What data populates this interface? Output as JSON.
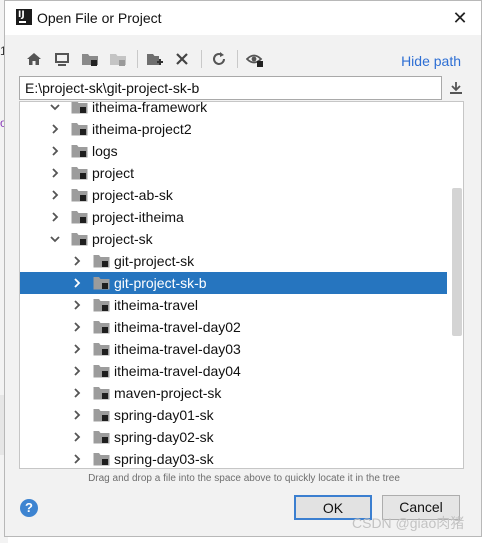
{
  "window": {
    "title": "Open File or Project",
    "app_icon": "intellij-icon"
  },
  "background": {
    "marks": [
      "1",
      "o"
    ]
  },
  "toolbar": {
    "buttons": [
      {
        "name": "home-icon"
      },
      {
        "name": "desktop-icon"
      },
      {
        "name": "project-folder-icon"
      },
      {
        "name": "module-folder-icon",
        "disabled": true
      },
      {
        "name": "new-folder-icon"
      },
      {
        "name": "delete-icon"
      },
      {
        "name": "refresh-icon"
      },
      {
        "name": "show-hidden-icon"
      }
    ],
    "hide_path_label": "Hide path"
  },
  "path_input": {
    "value": "E:\\project-sk\\git-project-sk-b",
    "download_icon": "download-icon"
  },
  "tree": {
    "rows": [
      {
        "label": "itheima-framework",
        "level": 1,
        "expanded": true
      },
      {
        "label": "itheima-project2",
        "level": 1,
        "expanded": false
      },
      {
        "label": "logs",
        "level": 1,
        "expanded": false
      },
      {
        "label": "project",
        "level": 1,
        "expanded": false
      },
      {
        "label": "project-ab-sk",
        "level": 1,
        "expanded": false
      },
      {
        "label": "project-itheima",
        "level": 1,
        "expanded": false
      },
      {
        "label": "project-sk",
        "level": 1,
        "expanded": true
      },
      {
        "label": "git-project-sk",
        "level": 2,
        "expanded": false
      },
      {
        "label": "git-project-sk-b",
        "level": 2,
        "expanded": false,
        "selected": true
      },
      {
        "label": "itheima-travel",
        "level": 2,
        "expanded": false
      },
      {
        "label": "itheima-travel-day02",
        "level": 2,
        "expanded": false
      },
      {
        "label": "itheima-travel-day03",
        "level": 2,
        "expanded": false
      },
      {
        "label": "itheima-travel-day04",
        "level": 2,
        "expanded": false
      },
      {
        "label": "maven-project-sk",
        "level": 2,
        "expanded": false
      },
      {
        "label": "spring-day01-sk",
        "level": 2,
        "expanded": false
      },
      {
        "label": "spring-day02-sk",
        "level": 2,
        "expanded": false
      },
      {
        "label": "spring-day03-sk",
        "level": 2,
        "expanded": false
      }
    ]
  },
  "hint_text": "Drag and drop a file into the space above to quickly locate it in the tree",
  "buttons": {
    "help": "?",
    "ok": "OK",
    "cancel": "Cancel"
  },
  "watermark": "CSDN @giao肉猪",
  "colors": {
    "selection": "#2675bf",
    "link": "#2e6fd4",
    "default_button_border": "#3b7fd0"
  }
}
